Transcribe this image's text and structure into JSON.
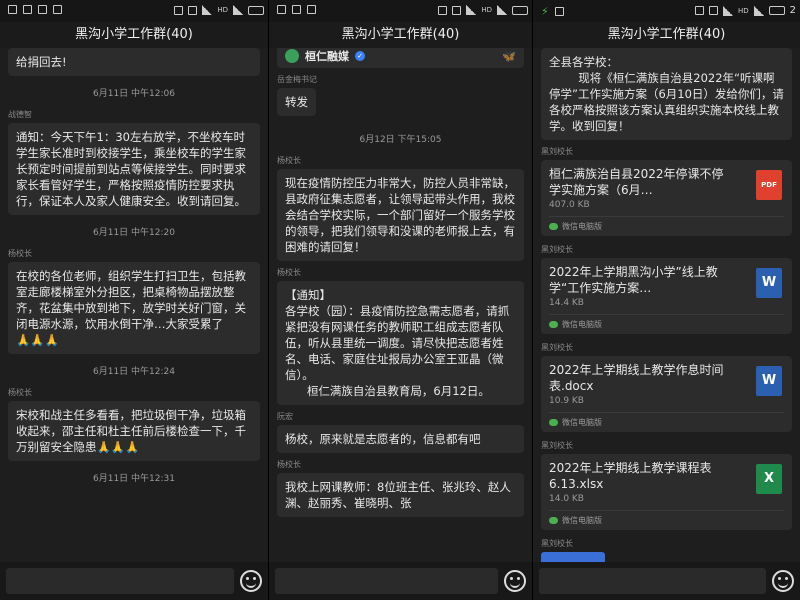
{
  "status": {
    "left_icons": [
      "notif-icon",
      "image-icon",
      "wechat-icon",
      "phone-icon"
    ],
    "right_icons": [
      "vibrate-icon",
      "alarm-icon",
      "wifi-icon",
      "signal-icon",
      "battery-icon"
    ],
    "net": "HD",
    "clock_partial": "2"
  },
  "chat_title": "黑沟小学工作群(40)",
  "panel1": {
    "top_bubble": "给捐回去!",
    "time1": "6月11日 中午12:06",
    "sender1": "战德智",
    "msg1": "通知：今天下午1：30左右放学，不坐校车时学生家长准时到校接学生，乘坐校车的学生家长预定时间提前到站点等候接学生。同时要求家长看管好学生，严格按照疫情防控要求执行，保证本人及家人健康安全。收到请回复。",
    "time2": "6月11日 中午12:20",
    "sender2": "杨校长",
    "msg2": "在校的各位老师，组织学生打扫卫生，包括教室走廊楼梯室外分担区，把桌椅物品摆放整齐，花盆集中放到地下，放学时关好门窗，关闭电源水源，饮用水倒干净…大家受累了",
    "msg2_emoji": "🙏🙏🙏",
    "time3": "6月11日 中午12:24",
    "sender3": "杨校长",
    "msg3": "宋校和战主任多看看，把垃圾倒干净，垃圾箱收起来，邵主任和杜主任前后楼检查一下，千万别留安全隐患",
    "msg3_emoji": "🙏🙏🙏",
    "time4": "6月11日 中午12:31"
  },
  "panel2": {
    "media_name": "桓仁融媒",
    "media_tail": "🦋",
    "sender0": "岳金梅书记",
    "msg0": "转发",
    "time1": "6月12日 下午15:05",
    "sender1": "杨校长",
    "msg1": "现在疫情防控压力非常大，防控人员非常缺，县政府征集志愿者，让领导起带头作用，我校会结合学校实际，一个部门留好一个服务学校的领导，把我们领导和没课的老师报上去，有困难的请回复！",
    "sender2": "杨校长",
    "msg2": "【通知】\n各学校（园）：县疫情防控急需志愿者，请抓紧把没有网课任务的教师职工组成志愿者队伍，听从县里统一调度。请尽快把志愿者姓名、电话、家庭住址报局办公室王亚晶（微信）。\n      桓仁满族自治县教育局，6月12日。",
    "sender3": "阮宏",
    "msg3": "杨校，原来就是志愿者的，信息都有吧",
    "sender4": "杨校长",
    "msg4": "我校上网课教师：8位班主任、张兆玲、赵人渊、赵丽秀、崔晓明、张"
  },
  "panel3": {
    "top_bubble": "全县各学校：\n        现将《桓仁满族自治县2022年“听课啊停学”工作实施方案（6月10日）发给你们，请各校严格按照该方案认真组织实施本校线上教学。收到回复！",
    "files": [
      {
        "sender": "黑刘校长",
        "name": "桓仁满族治自县2022年停课不停学实施方案（6月…",
        "size": "407.0 KB",
        "type": "PDF",
        "footer": "微信电脑版"
      },
      {
        "sender": "黑刘校长",
        "name": "2022年上学期黑沟小学”线上教学“工作实施方案…",
        "size": "14.4 KB",
        "type": "W",
        "footer": "微信电脑版"
      },
      {
        "sender": "黑刘校长",
        "name": "2022年上学期线上教学作息时间表.docx",
        "size": "10.9 KB",
        "type": "W",
        "footer": "微信电脑版"
      },
      {
        "sender": "黑刘校长",
        "name": "2022年上学期线上教学课程表 6.13.xlsx",
        "size": "14.0 KB",
        "type": "X",
        "footer": "微信电脑版"
      }
    ],
    "sender_last": "黑刘校长"
  }
}
